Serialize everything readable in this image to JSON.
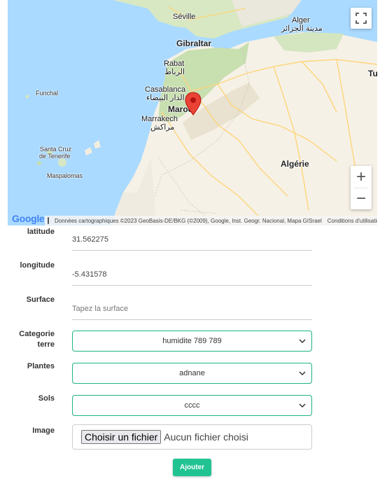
{
  "map": {
    "labels": {
      "seville": "Séville",
      "gibraltar": "Gibraltar",
      "alger": "Alger",
      "alger_ar": "مدينة الجزائر",
      "rabat": "Rabat",
      "rabat_ar": "الرباط",
      "casablanca": "Casablanca",
      "casablanca_ar": "الدار البيضاء",
      "maroc": "Maroc",
      "marrakech": "Marrakech",
      "marrakech_ar": "مراكش",
      "funchal": "Funchal",
      "santa_cruz_1": "Santa Cruz",
      "santa_cruz_2": "de Tenerife",
      "maspalomas": "Maspalomas",
      "algerie": "Algérie",
      "tunis_partial": "Tu"
    },
    "google_logo": "Google",
    "attribution": "Données cartographiques ©2023 GeoBasis-DE/BKG (©2009), Google, Inst. Geogr. Nacional, Mapa GISrael",
    "terms": "Conditions d'utilisation",
    "zoom_in": "+",
    "zoom_out": "−",
    "icons": {
      "fullscreen": "fullscreen-icon",
      "marker": "map-pin-icon",
      "keyboard": "keyboard-icon"
    },
    "colors": {
      "water": "#aadaff",
      "land": "#f6f1e6",
      "green": "#c8dfb0",
      "marker": "#ea4335",
      "roads": "#fdd57a"
    }
  },
  "form": {
    "latitude": {
      "label": "latitude",
      "value": "31.562275"
    },
    "longitude": {
      "label": "longitude",
      "value": "-5.431578"
    },
    "surface": {
      "label": "Surface",
      "placeholder": "Tapez la surface"
    },
    "categorie": {
      "label_1": "Categorie",
      "label_2": "terre",
      "value": "humidite 789 789"
    },
    "plantes": {
      "label": "Plantes",
      "value": "adnane"
    },
    "sols": {
      "label": "Sols",
      "value": "cccc"
    },
    "image": {
      "label": "Image",
      "button": "Choisir un fichier",
      "status": "Aucun fichier choisi"
    },
    "submit": "Ajouter",
    "accent_color": "#20c391"
  }
}
